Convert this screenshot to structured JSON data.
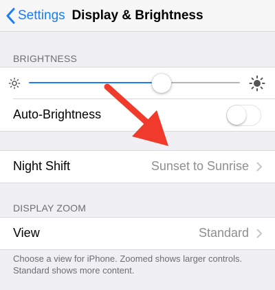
{
  "nav": {
    "back_label": "Settings",
    "title": "Display & Brightness"
  },
  "brightness": {
    "header": "BRIGHTNESS",
    "level_percent": 63,
    "auto_label": "Auto-Brightness",
    "auto_enabled": false
  },
  "night_shift": {
    "label": "Night Shift",
    "value": "Sunset to Sunrise"
  },
  "display_zoom": {
    "header": "DISPLAY ZOOM",
    "view_label": "View",
    "view_value": "Standard",
    "footer": "Choose a view for iPhone. Zoomed shows larger controls. Standard shows more content."
  },
  "annotation": {
    "arrow_color": "#f03a2c"
  },
  "colors": {
    "accent": "#1a7cf7",
    "background": "#efeff4",
    "secondary_text": "#8e8e93"
  },
  "icons": [
    "chevron-left-icon",
    "sun-small-icon",
    "sun-large-icon",
    "chevron-right-icon",
    "arrow-icon"
  ]
}
